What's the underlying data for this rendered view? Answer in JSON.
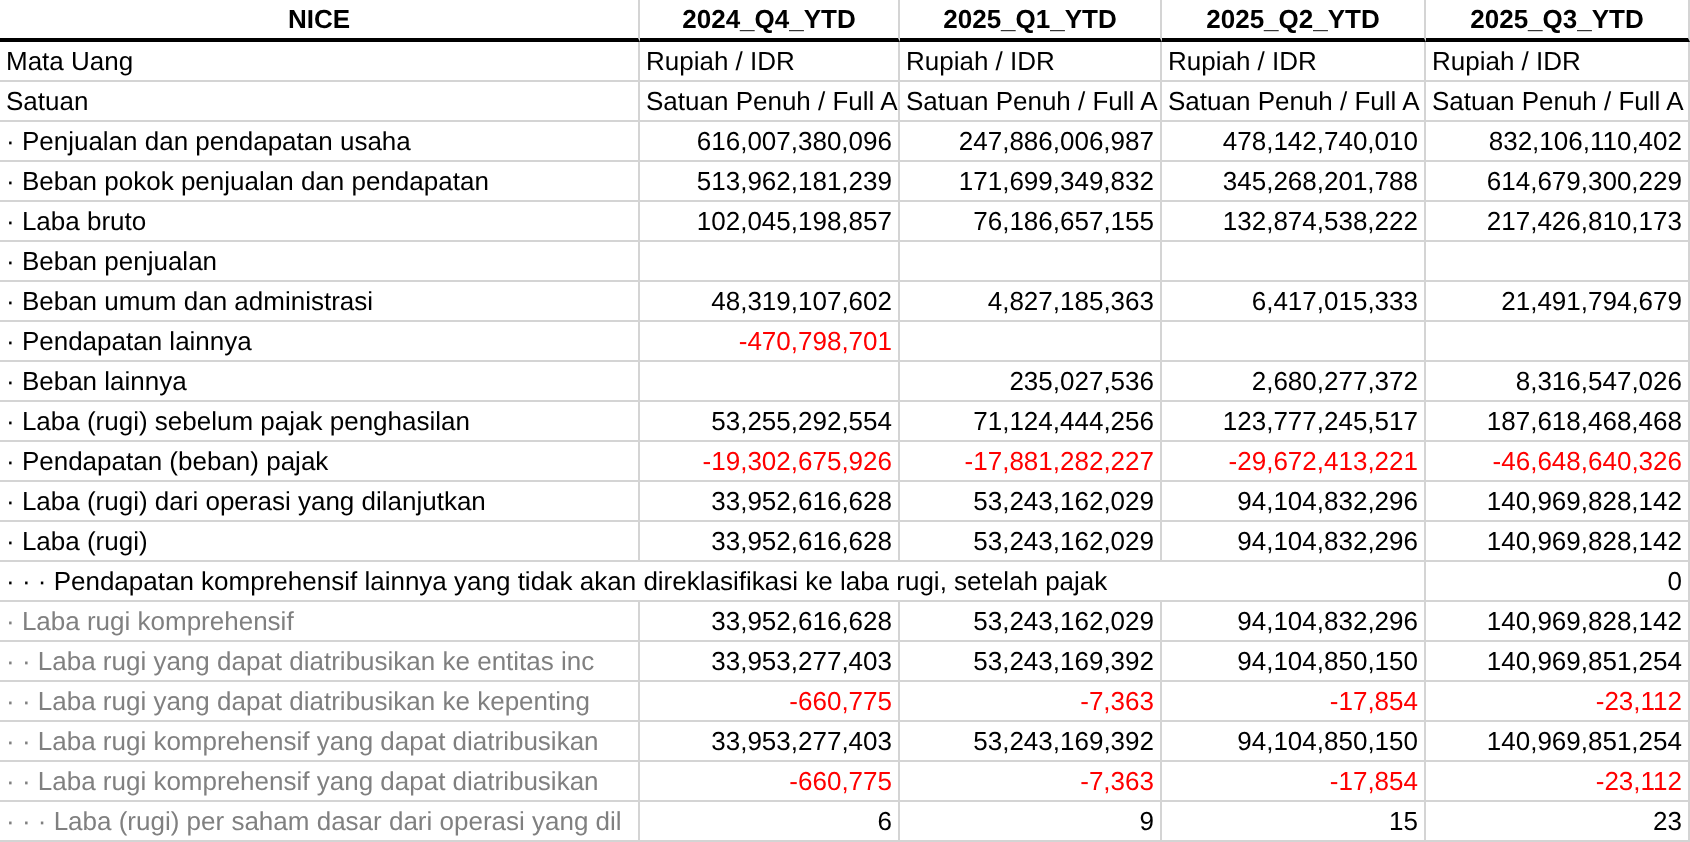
{
  "table": {
    "columns": [
      "NICE",
      "2024_Q4_YTD",
      "2025_Q1_YTD",
      "2025_Q2_YTD",
      "2025_Q3_YTD"
    ],
    "rows": [
      {
        "kind": "text",
        "cells": [
          {
            "text": "Mata Uang",
            "muted": false
          },
          {
            "text": "Rupiah / IDR",
            "negative": false
          },
          {
            "text": "Rupiah / IDR",
            "negative": false
          },
          {
            "text": "Rupiah / IDR",
            "negative": false
          },
          {
            "text": "Rupiah / IDR",
            "negative": false
          }
        ]
      },
      {
        "kind": "text",
        "cells": [
          {
            "text": "Satuan",
            "muted": false
          },
          {
            "text": "Satuan Penuh / Full A",
            "negative": false
          },
          {
            "text": "Satuan Penuh / Full A",
            "negative": false
          },
          {
            "text": "Satuan Penuh / Full A",
            "negative": false
          },
          {
            "text": "Satuan Penuh / Full A",
            "negative": false
          }
        ]
      },
      {
        "kind": "number",
        "cells": [
          {
            "text": "· Penjualan dan pendapatan usaha",
            "muted": false
          },
          {
            "text": "616,007,380,096",
            "negative": false
          },
          {
            "text": "247,886,006,987",
            "negative": false
          },
          {
            "text": "478,142,740,010",
            "negative": false
          },
          {
            "text": "832,106,110,402",
            "negative": false
          }
        ]
      },
      {
        "kind": "number",
        "cells": [
          {
            "text": "· Beban pokok penjualan dan pendapatan",
            "muted": false
          },
          {
            "text": "513,962,181,239",
            "negative": false
          },
          {
            "text": "171,699,349,832",
            "negative": false
          },
          {
            "text": "345,268,201,788",
            "negative": false
          },
          {
            "text": "614,679,300,229",
            "negative": false
          }
        ]
      },
      {
        "kind": "number",
        "cells": [
          {
            "text": "· Laba bruto",
            "muted": false
          },
          {
            "text": "102,045,198,857",
            "negative": false
          },
          {
            "text": "76,186,657,155",
            "negative": false
          },
          {
            "text": "132,874,538,222",
            "negative": false
          },
          {
            "text": "217,426,810,173",
            "negative": false
          }
        ]
      },
      {
        "kind": "number",
        "cells": [
          {
            "text": "· Beban penjualan",
            "muted": false
          },
          null,
          null,
          null,
          null
        ]
      },
      {
        "kind": "number",
        "cells": [
          {
            "text": "· Beban umum dan administrasi",
            "muted": false
          },
          {
            "text": "48,319,107,602",
            "negative": false
          },
          {
            "text": "4,827,185,363",
            "negative": false
          },
          {
            "text": "6,417,015,333",
            "negative": false
          },
          {
            "text": "21,491,794,679",
            "negative": false
          }
        ]
      },
      {
        "kind": "number",
        "cells": [
          {
            "text": "· Pendapatan lainnya",
            "muted": false
          },
          {
            "text": "-470,798,701",
            "negative": true
          },
          null,
          null,
          null
        ]
      },
      {
        "kind": "number",
        "cells": [
          {
            "text": "· Beban lainnya",
            "muted": false
          },
          null,
          {
            "text": "235,027,536",
            "negative": false
          },
          {
            "text": "2,680,277,372",
            "negative": false
          },
          {
            "text": "8,316,547,026",
            "negative": false
          }
        ]
      },
      {
        "kind": "number",
        "cells": [
          {
            "text": "· Laba (rugi) sebelum pajak penghasilan",
            "muted": false
          },
          {
            "text": "53,255,292,554",
            "negative": false
          },
          {
            "text": "71,124,444,256",
            "negative": false
          },
          {
            "text": "123,777,245,517",
            "negative": false
          },
          {
            "text": "187,618,468,468",
            "negative": false
          }
        ]
      },
      {
        "kind": "number",
        "cells": [
          {
            "text": "· Pendapatan (beban) pajak",
            "muted": false
          },
          {
            "text": "-19,302,675,926",
            "negative": true
          },
          {
            "text": "-17,881,282,227",
            "negative": true
          },
          {
            "text": "-29,672,413,221",
            "negative": true
          },
          {
            "text": "-46,648,640,326",
            "negative": true
          }
        ]
      },
      {
        "kind": "number",
        "cells": [
          {
            "text": "· Laba (rugi) dari operasi yang dilanjutkan",
            "muted": false
          },
          {
            "text": "33,952,616,628",
            "negative": false
          },
          {
            "text": "53,243,162,029",
            "negative": false
          },
          {
            "text": "94,104,832,296",
            "negative": false
          },
          {
            "text": "140,969,828,142",
            "negative": false
          }
        ]
      },
      {
        "kind": "number",
        "cells": [
          {
            "text": "· Laba (rugi)",
            "muted": false
          },
          {
            "text": "33,952,616,628",
            "negative": false
          },
          {
            "text": "53,243,162,029",
            "negative": false
          },
          {
            "text": "94,104,832,296",
            "negative": false
          },
          {
            "text": "140,969,828,142",
            "negative": false
          }
        ]
      },
      {
        "kind": "span",
        "cells": [
          {
            "text": "· · · Pendapatan komprehensif lainnya yang tidak akan direklasifikasi ke laba rugi, setelah pajak",
            "muted": false
          },
          null,
          null,
          null,
          {
            "text": "0",
            "negative": false
          }
        ]
      },
      {
        "kind": "number",
        "cells": [
          {
            "text": "· Laba rugi komprehensif",
            "muted": true
          },
          {
            "text": "33,952,616,628",
            "negative": false
          },
          {
            "text": "53,243,162,029",
            "negative": false
          },
          {
            "text": "94,104,832,296",
            "negative": false
          },
          {
            "text": "140,969,828,142",
            "negative": false
          }
        ]
      },
      {
        "kind": "number",
        "cells": [
          {
            "text": "· · Laba rugi yang dapat diatribusikan ke entitas inc",
            "muted": true
          },
          {
            "text": "33,953,277,403",
            "negative": false
          },
          {
            "text": "53,243,169,392",
            "negative": false
          },
          {
            "text": "94,104,850,150",
            "negative": false
          },
          {
            "text": "140,969,851,254",
            "negative": false
          }
        ]
      },
      {
        "kind": "number",
        "cells": [
          {
            "text": "· · Laba rugi yang dapat diatribusikan ke kepenting",
            "muted": true
          },
          {
            "text": "-660,775",
            "negative": true
          },
          {
            "text": "-7,363",
            "negative": true
          },
          {
            "text": "-17,854",
            "negative": true
          },
          {
            "text": "-23,112",
            "negative": true
          }
        ]
      },
      {
        "kind": "number",
        "cells": [
          {
            "text": "· · Laba rugi komprehensif yang dapat diatribusikan",
            "muted": true
          },
          {
            "text": "33,953,277,403",
            "negative": false
          },
          {
            "text": "53,243,169,392",
            "negative": false
          },
          {
            "text": "94,104,850,150",
            "negative": false
          },
          {
            "text": "140,969,851,254",
            "negative": false
          }
        ]
      },
      {
        "kind": "number",
        "cells": [
          {
            "text": "· · Laba rugi komprehensif yang dapat diatribusikan",
            "muted": true
          },
          {
            "text": "-660,775",
            "negative": true
          },
          {
            "text": "-7,363",
            "negative": true
          },
          {
            "text": "-17,854",
            "negative": true
          },
          {
            "text": "-23,112",
            "negative": true
          }
        ]
      },
      {
        "kind": "number",
        "cells": [
          {
            "text": "· · · Laba (rugi) per saham dasar dari operasi yang dil",
            "muted": true
          },
          {
            "text": "6",
            "negative": false
          },
          {
            "text": "9",
            "negative": false
          },
          {
            "text": "15",
            "negative": false
          },
          {
            "text": "23",
            "negative": false
          }
        ]
      }
    ]
  }
}
